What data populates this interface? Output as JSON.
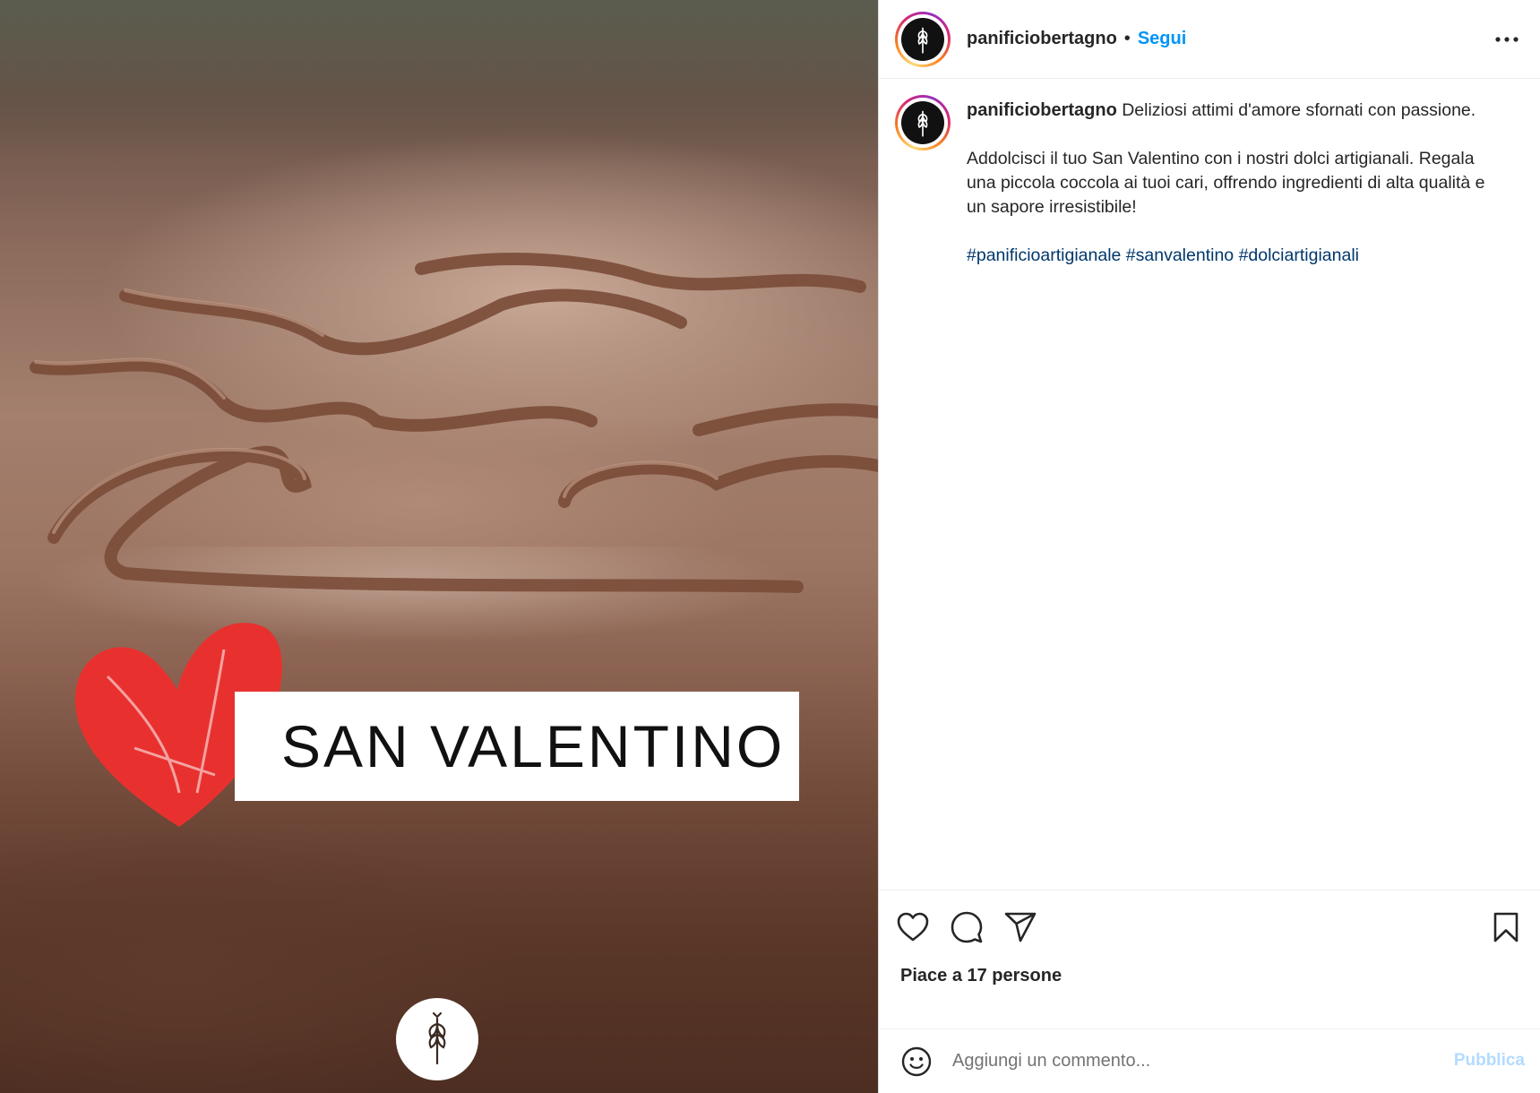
{
  "post": {
    "image_text": "SAN VALENTINO",
    "username": "panificiobertagno",
    "separator": "•",
    "follow_label": "Segui",
    "more_icon": "more-options-icon",
    "caption": {
      "username": "panificiobertagno",
      "line1": "Deliziosi attimi d'amore sfornati con passione.",
      "paragraph2": "Addolcisci il tuo San Valentino con i nostri dolci artigianali. Regala una piccola coccola ai tuoi cari, offrendo ingredienti di alta qualità e un sapore irresistibile!",
      "hashtags": [
        "#panificioartigianale",
        "#sanvalentino",
        "#dolciartigianali"
      ]
    },
    "actions": {
      "icons": [
        "heart-icon",
        "comment-icon",
        "share-icon",
        "bookmark-icon"
      ]
    },
    "likes_text": "Piace a 17 persone",
    "comment": {
      "placeholder": "Aggiungi un commento...",
      "publish_label": "Pubblica"
    }
  },
  "colors": {
    "link_blue": "#0095f6",
    "hashtag": "#00376b",
    "publish_disabled": "#b3dbff",
    "heart_red": "#e8312f"
  }
}
